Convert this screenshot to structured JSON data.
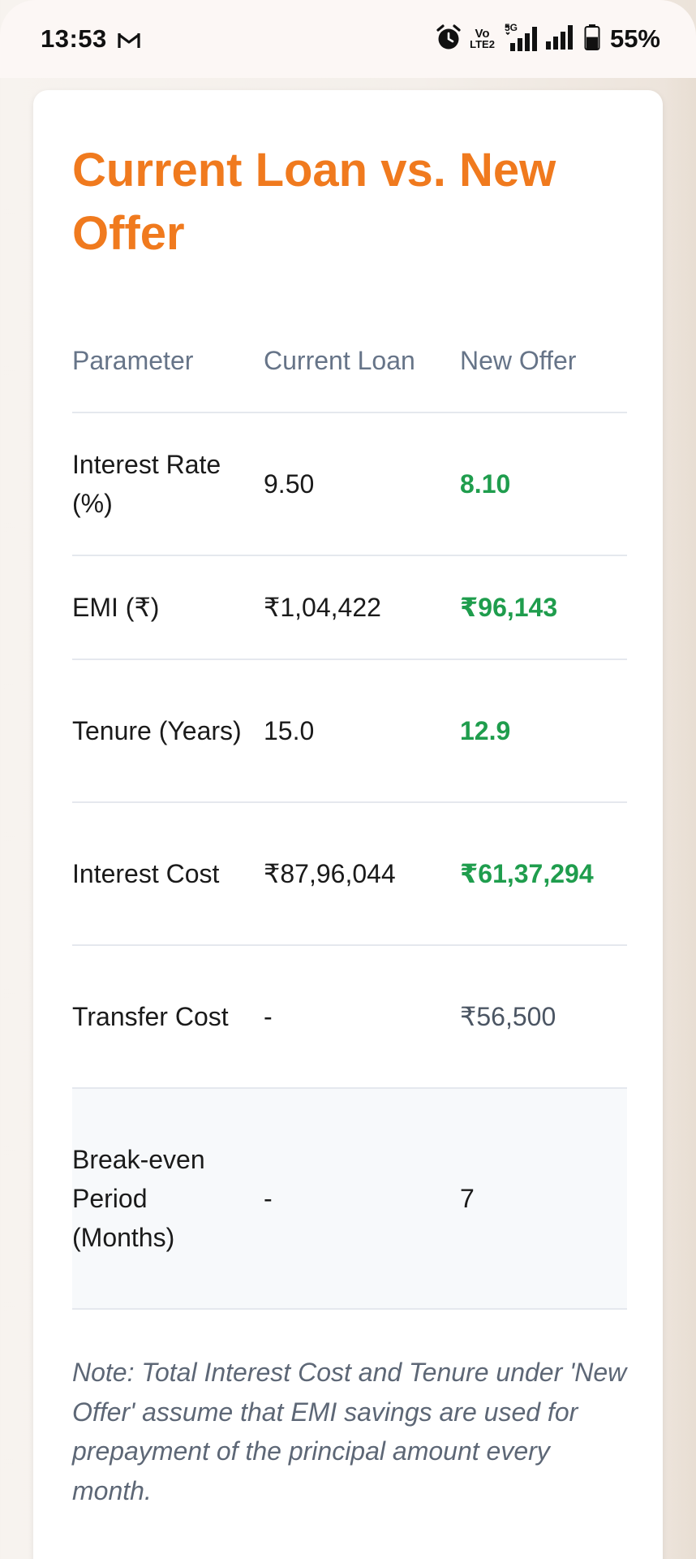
{
  "status_bar": {
    "time": "13:53",
    "mail_icon": "gmail-icon",
    "alarm_icon": "alarm-icon",
    "volte_text_top": "Vo",
    "volte_text_bottom": "LTE2",
    "network_label": "5G",
    "battery_percent": "55%",
    "battery_level": 0.55
  },
  "card": {
    "title": "Current Loan vs. New Offer",
    "table": {
      "headers": {
        "parameter": "Parameter",
        "current": "Current Loan",
        "new_offer": "New Offer"
      },
      "rows": [
        {
          "parameter": "Interest Rate (%)",
          "current": "9.50",
          "new_offer": "8.10"
        },
        {
          "parameter": "EMI (₹)",
          "current": "₹1,04,422",
          "new_offer": "₹96,143"
        },
        {
          "parameter": "Tenure (Years)",
          "current": "15.0",
          "new_offer": "12.9"
        },
        {
          "parameter": "Interest Cost",
          "current": "₹87,96,044",
          "new_offer": "₹61,37,294"
        },
        {
          "parameter": "Transfer Cost",
          "current": "-",
          "new_offer": "₹56,500"
        },
        {
          "parameter": "Break-even Period (Months)",
          "current": "-",
          "new_offer": "7"
        }
      ]
    },
    "note": "Note: Total Interest Cost and Tenure under 'New Offer' assume that EMI savings are used for prepayment of the principal amount every month."
  },
  "colors": {
    "title": "#f07a1e",
    "positive": "#1f9d4d",
    "header_text": "#667488",
    "note_text": "#5d6776"
  }
}
